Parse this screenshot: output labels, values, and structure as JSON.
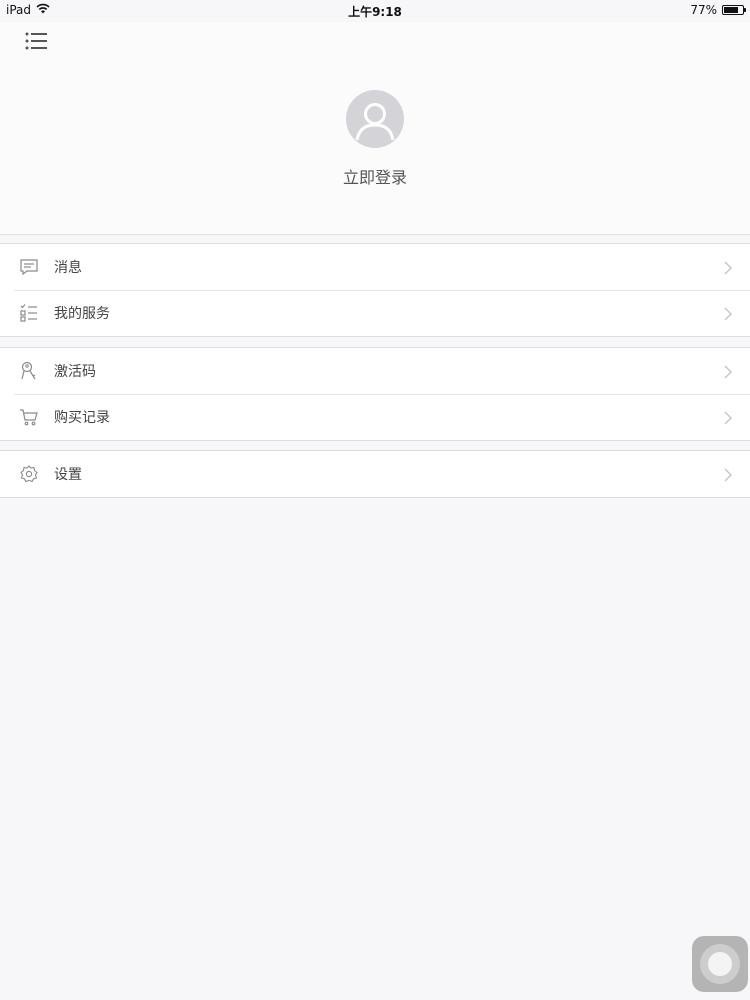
{
  "status_bar": {
    "device": "iPad",
    "wifi_icon": "wifi-icon",
    "time": "上午9:18",
    "battery_percent": "77%",
    "battery_level": 0.77
  },
  "header": {
    "menu_icon": "list-menu-icon",
    "avatar_icon": "user-avatar-icon",
    "login_label": "立即登录"
  },
  "menu_groups": [
    {
      "items": [
        {
          "icon": "message-icon",
          "label": "消息"
        },
        {
          "icon": "service-list-icon",
          "label": "我的服务"
        }
      ]
    },
    {
      "items": [
        {
          "icon": "key-icon",
          "label": "激活码"
        },
        {
          "icon": "cart-icon",
          "label": "购买记录"
        }
      ]
    },
    {
      "items": [
        {
          "icon": "gear-icon",
          "label": "设置"
        }
      ]
    }
  ],
  "colors": {
    "background": "#f7f6f9",
    "icon_gray": "#8a8a8e",
    "chevron_gray": "#c4c4c8",
    "avatar_gray": "#d4d4d8"
  }
}
